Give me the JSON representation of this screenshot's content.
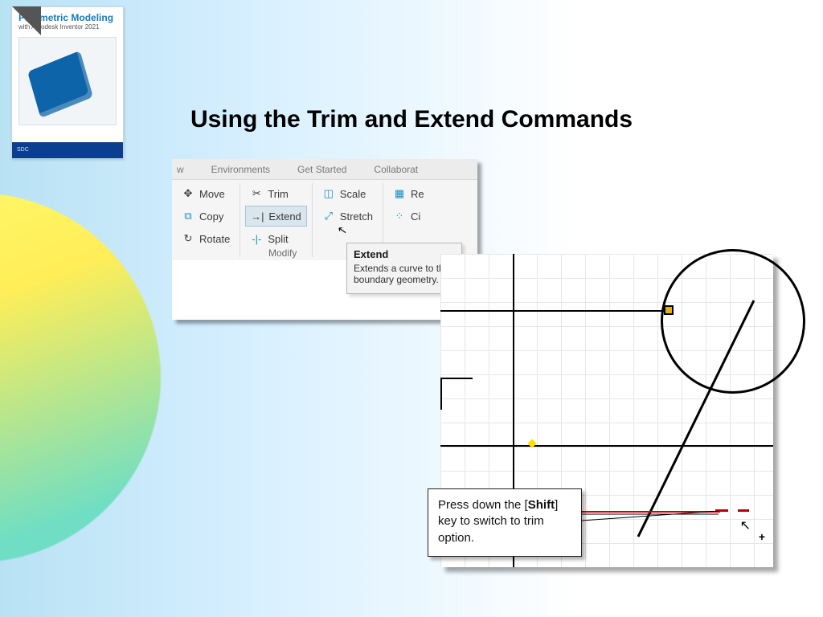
{
  "book": {
    "title": "Parametric Modeling",
    "subtitle": "with Autodesk Inventor 2021",
    "publisher": "SDC"
  },
  "heading": "Using the Trim and Extend Commands",
  "ribbon": {
    "tabs": [
      "w",
      "Environments",
      "Get Started",
      "Collaborat"
    ],
    "col1": [
      {
        "icon": "move-icon",
        "label": "Move"
      },
      {
        "icon": "copy-icon",
        "label": "Copy"
      },
      {
        "icon": "rotate-icon",
        "label": "Rotate"
      }
    ],
    "col2": [
      {
        "icon": "trim-icon",
        "label": "Trim"
      },
      {
        "icon": "extend-icon",
        "label": "Extend",
        "hi": true
      },
      {
        "icon": "split-icon",
        "label": "Split"
      }
    ],
    "col3": [
      {
        "icon": "scale-icon",
        "label": "Scale"
      },
      {
        "icon": "stretch-icon",
        "label": "Stretch"
      }
    ],
    "col4": [
      {
        "icon": "rect-array-icon",
        "label": "Re"
      },
      {
        "icon": "circ-array-icon",
        "label": "Ci"
      }
    ],
    "panel_label": "Modify",
    "tooltip": {
      "title": "Extend",
      "body": "Extends a curve to the boundary geometry."
    }
  },
  "callout": {
    "pre": "Press down the [",
    "key": "Shift",
    "post": "] key to switch to trim option."
  },
  "icons": {
    "move-icon": "✥",
    "copy-icon": "⧉",
    "rotate-icon": "↻",
    "trim-icon": "✂",
    "extend-icon": "→|",
    "split-icon": "-|-",
    "scale-icon": "◫",
    "stretch-icon": "⤢",
    "rect-array-icon": "▦",
    "circ-array-icon": "⁘",
    "cursor-icon": "↖",
    "plus-icon": "+"
  }
}
